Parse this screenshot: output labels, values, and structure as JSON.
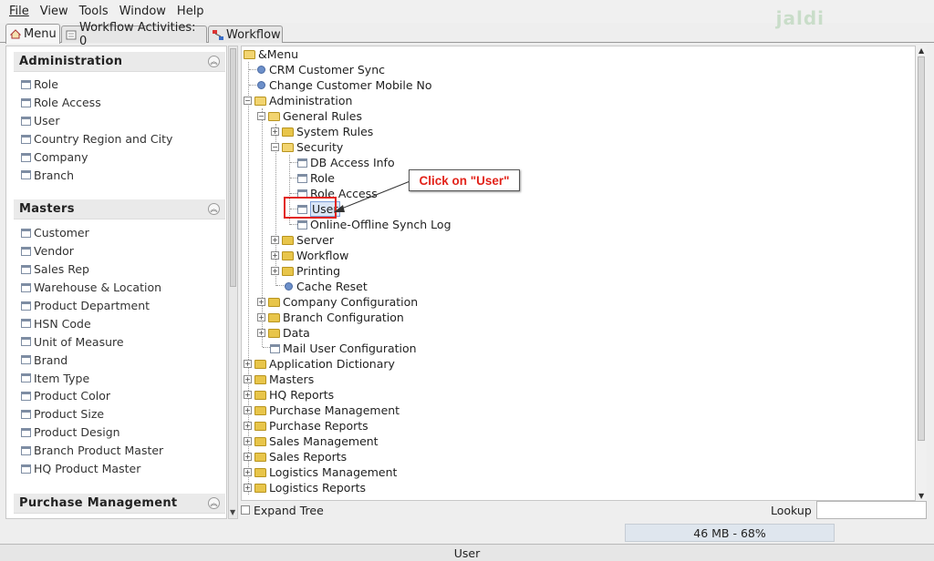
{
  "menubar": {
    "items": [
      {
        "label": "File"
      },
      {
        "label": "View"
      },
      {
        "label": "Tools"
      },
      {
        "label": "Window"
      },
      {
        "label": "Help"
      }
    ],
    "logo_text": "jaldi"
  },
  "tabs": {
    "menu": "Menu",
    "workflow_activities": "Workflow Activities: 0",
    "workflow": "Workflow"
  },
  "sidebar": {
    "administration": {
      "title": "Administration",
      "items": [
        "Role",
        "Role Access",
        "User",
        "Country Region and City",
        "Company",
        "Branch"
      ]
    },
    "masters": {
      "title": "Masters",
      "items": [
        "Customer",
        "Vendor",
        "Sales Rep",
        "Warehouse & Location",
        "Product Department",
        "HSN Code",
        "Unit of Measure",
        "Brand",
        "Item Type",
        "Product Color",
        "Product Size",
        "Product Design",
        "Branch Product Master",
        "HQ Product Master"
      ]
    },
    "purchase_management": {
      "title": "Purchase Management"
    }
  },
  "tree": {
    "root": "&Menu",
    "nodes": {
      "crm": "CRM Customer Sync",
      "change_mobile": "Change Customer Mobile No",
      "administration": "Administration",
      "general_rules": "General Rules",
      "system_rules": "System Rules",
      "security": "Security",
      "db_access": "DB Access Info",
      "role": "Role",
      "role_access": "Role Access",
      "user": "User",
      "online_offline": "Online-Offline Synch Log",
      "server": "Server",
      "workflow": "Workflow",
      "printing": "Printing",
      "cache_reset": "Cache Reset",
      "company_config": "Company Configuration",
      "branch_config": "Branch Configuration",
      "data": "Data",
      "mail_user": "Mail User Configuration",
      "app_dictionary": "Application Dictionary",
      "masters": "Masters",
      "hq_reports": "HQ Reports",
      "purchase_mgmt": "Purchase Management",
      "purchase_reports": "Purchase Reports",
      "sales_mgmt": "Sales Management",
      "sales_reports": "Sales Reports",
      "logistics_mgmt": "Logistics Management",
      "logistics_reports": "Logistics Reports"
    }
  },
  "annotation": {
    "callout_text": "Click on \"User\""
  },
  "bottom": {
    "expand_tree": "Expand Tree",
    "lookup": "Lookup",
    "lookup_value": "",
    "memory": "46 MB - 68%",
    "status": "User"
  },
  "colors": {
    "accent": "#e2231a",
    "folder": "#e8c54a",
    "memory_bar": "#dfe6ee"
  }
}
